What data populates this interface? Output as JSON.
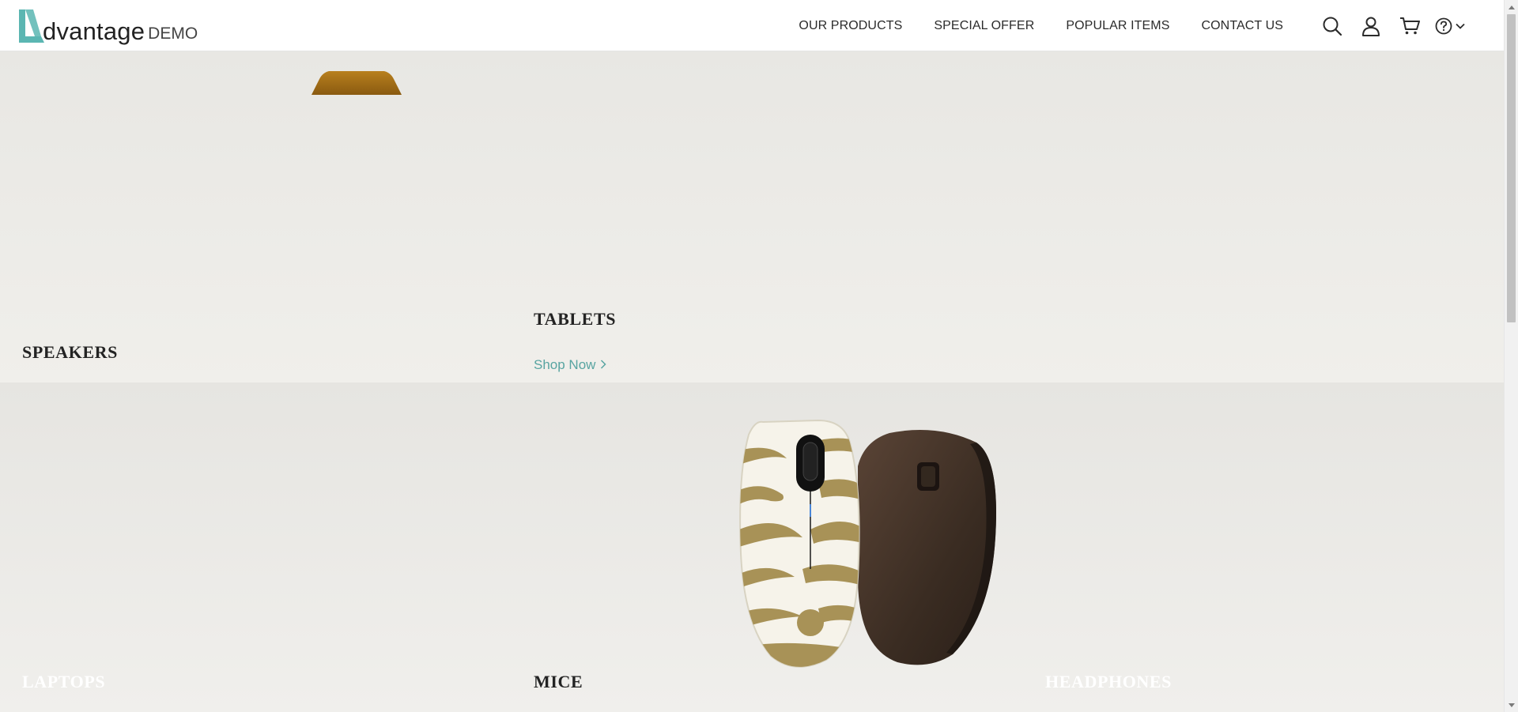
{
  "header": {
    "logo_word": "dvantage",
    "logo_demo": "DEMO",
    "nav": [
      {
        "label": "OUR PRODUCTS"
      },
      {
        "label": "SPECIAL OFFER"
      },
      {
        "label": "POPULAR ITEMS"
      },
      {
        "label": "CONTACT US"
      }
    ],
    "icons": [
      "search-icon",
      "user-icon",
      "cart-icon",
      "help-icon",
      "chevron-down-icon"
    ]
  },
  "categories": {
    "speakers": {
      "title": "SPEAKERS"
    },
    "tablets": {
      "title": "TABLETS",
      "shop_now": "Shop Now"
    },
    "laptops": {
      "title": "LAPTOPS"
    },
    "mice": {
      "title": "MICE"
    },
    "headphones": {
      "title": "HEADPHONES"
    }
  },
  "colors": {
    "accent": "#58a4a1",
    "logo_teal": "#5bb6b2",
    "tile_bg": "#eeede9"
  }
}
